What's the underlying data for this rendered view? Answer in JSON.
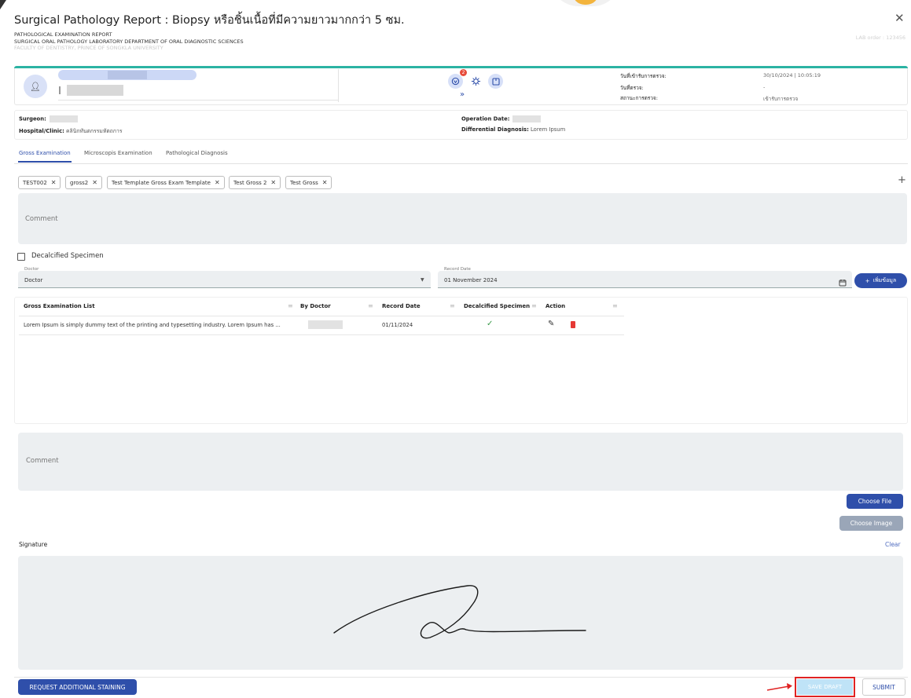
{
  "dialog": {
    "title": "Surgical Pathology Report : Biopsy หรือชิ้นเนื้อที่มีความยาวมากกว่า 5 ซม.",
    "close_icon": "close-icon"
  },
  "report_header": {
    "line1": "PATHOLOGICAL EXAMINATION REPORT",
    "line2": "SURGICAL ORAL PATHOLOGY LABORATORY DEPARTMENT OF ORAL DIAGNOSTIC SCIENCES",
    "line3": "FACULTY OF DENTISTRY, PRINCE OF SONGKLA UNIVERSITY",
    "lab_order": "LAB order : 123456"
  },
  "patient": {
    "dates": [
      {
        "label": "วันที่เข้ารับการตรวจ:",
        "value": "30/10/2024 | 10:05:19"
      },
      {
        "label": "วันที่ตรวจ:",
        "value": "-"
      },
      {
        "label": "สถานะการตรวจ:",
        "value": "เข้ารับการตรวจ"
      }
    ],
    "notification_count": "2"
  },
  "summary": {
    "surgeon_label": "Surgeon:",
    "hospital_label": "Hospital/Clinic:",
    "hospital_value": "คลินิกทันตกรรมหัตถการ",
    "operation_date_label": "Operation Date:",
    "diagnosis_label": "Differential Diagnosis:",
    "diagnosis_value": "Lorem Ipsum"
  },
  "tabs": [
    "Gross Examination",
    "Microscopis Examination",
    "Pathological Diagnosis"
  ],
  "templates": [
    "TEST002",
    "gross2",
    "Test Template Gross Exam Template",
    "Test Gross 2",
    "Test Gross"
  ],
  "comment_placeholder": "Comment",
  "decalcified_label": "Decalcified Specimen",
  "form": {
    "doctor_label": "Doctor",
    "doctor_value": "Doctor",
    "record_date_label": "Record Date",
    "record_date_value": "01 November 2024",
    "add_button": "เพิ่มข้อมูล"
  },
  "grid": {
    "columns": [
      "Gross Examination List",
      "By Doctor",
      "Record Date",
      "Decalcified Specimen",
      "Action"
    ],
    "rows": [
      {
        "text": "Lorem Ipsum is simply dummy text of the printing and typesetting industry. Lorem Ipsum has ...",
        "record_date": "01/11/2024"
      }
    ]
  },
  "bottom_comment_placeholder": "Comment",
  "buttons": {
    "choose_file": "Choose File",
    "choose_image": "Choose Image",
    "request_staining": "REQUEST ADDITIONAL STAINING",
    "save_draft": "SAVE DRAFT",
    "submit": "SUBMIT"
  },
  "signature": {
    "label": "Signature",
    "clear": "Clear"
  },
  "colors": {
    "primary": "#2f4faa",
    "accent_teal": "#2bb3a3",
    "highlight_red": "#e02323"
  }
}
